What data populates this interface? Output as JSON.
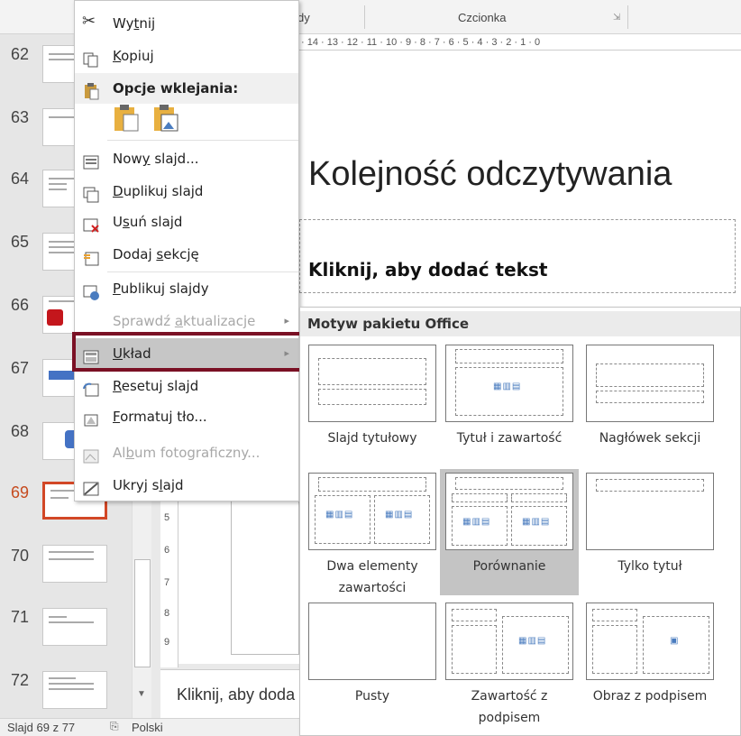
{
  "ribbon": {
    "group1": "dy",
    "group2": "Czcionka",
    "launcher": "⇲"
  },
  "ruler": {
    "h": "· 14 · 13 · 12 · 11 · 10 · 9 · 8 · 7 · 6 · 5 · 4 · 3 · 2 · 1 · 0",
    "v": [
      "5",
      "6",
      "7",
      "8",
      "9"
    ]
  },
  "thumbnails": [
    {
      "num": "62"
    },
    {
      "num": "63"
    },
    {
      "num": "64"
    },
    {
      "num": "65"
    },
    {
      "num": "66"
    },
    {
      "num": "67"
    },
    {
      "num": "68"
    },
    {
      "num": "69"
    },
    {
      "num": "70"
    },
    {
      "num": "71"
    },
    {
      "num": "72"
    }
  ],
  "slide": {
    "title": "Kolejność odczytywania",
    "placeholder": "Kliknij, aby dodać tekst",
    "notes": "Kliknij, aby doda"
  },
  "status": {
    "slide_count": "Slajd 69 z 77",
    "language": "Polski"
  },
  "menu": {
    "cut": {
      "pre": "Wy",
      "u": "t",
      "post": "nij"
    },
    "copy": {
      "pre": "",
      "u": "K",
      "post": "opiuj"
    },
    "paste_header": "Opcje wklejania:",
    "new_slide": {
      "pre": "Now",
      "u": "y",
      "post": " slajd..."
    },
    "duplicate": {
      "pre": "",
      "u": "D",
      "post": "uplikuj slajd"
    },
    "delete": {
      "pre": "U",
      "u": "s",
      "post": "uń slajd"
    },
    "add_section": {
      "pre": "Dodaj ",
      "u": "s",
      "post": "ekcję"
    },
    "publish": {
      "pre": "",
      "u": "P",
      "post": "ublikuj slajdy"
    },
    "check_updates": {
      "pre": "Sprawdź ",
      "u": "a",
      "post": "ktualizacje"
    },
    "layout": {
      "pre": "",
      "u": "U",
      "post": "kład"
    },
    "reset": {
      "pre": "",
      "u": "R",
      "post": "esetuj slajd"
    },
    "format_bg": {
      "pre": "",
      "u": "F",
      "post": "ormatuj tło..."
    },
    "album": {
      "pre": "Al",
      "u": "b",
      "post": "um fotograficzny..."
    },
    "hide": {
      "pre": "Ukryj s",
      "u": "l",
      "post": "ajd"
    }
  },
  "gallery": {
    "title": "Motyw pakietu Office",
    "layouts": [
      {
        "name": "Slajd tytułowy"
      },
      {
        "name": "Tytuł i zawartość"
      },
      {
        "name": "Nagłówek sekcji"
      },
      {
        "name": "Dwa elementy zawartości"
      },
      {
        "name": "Porównanie",
        "selected": true
      },
      {
        "name": "Tylko tytuł"
      },
      {
        "name": "Pusty"
      },
      {
        "name": "Zawartość z podpisem"
      },
      {
        "name": "Obraz z podpisem"
      }
    ]
  },
  "colors": {
    "highlight_frame": "#7a1024",
    "active_slide": "#d24726",
    "hover": "#c6c6c6"
  }
}
